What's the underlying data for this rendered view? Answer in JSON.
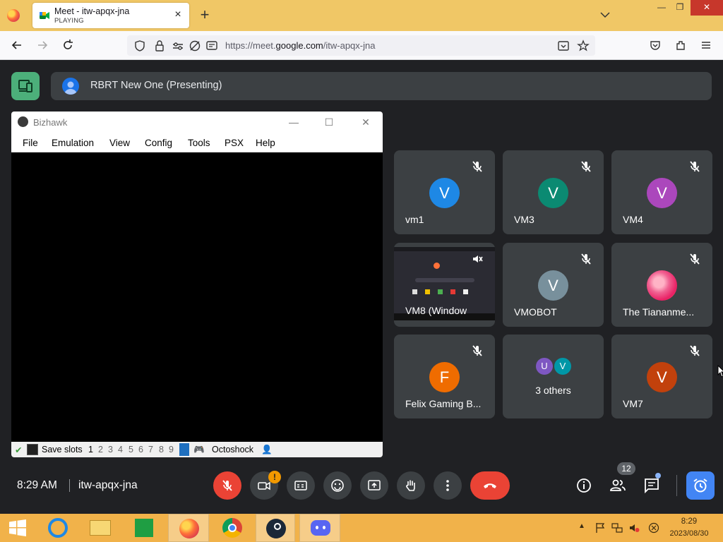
{
  "browser": {
    "tab": {
      "title": "Meet - itw-apqx-jna",
      "status": "PLAYING"
    },
    "url": {
      "prefix": "https://meet.",
      "domain": "google.com",
      "path": "/itw-apqx-jna"
    },
    "colors": {
      "tabstrip": "#f0c766"
    }
  },
  "meet": {
    "presenting_label": "RBRT New One (Presenting)",
    "shared_window": {
      "title": "Bizhawk",
      "menu": [
        "File",
        "Emulation",
        "View",
        "Config",
        "Tools",
        "PSX",
        "Help"
      ],
      "status": {
        "save_slots_label": "Save slots",
        "slots": [
          "1",
          "2",
          "3",
          "4",
          "5",
          "6",
          "7",
          "8",
          "9"
        ],
        "core": "Octoshock"
      }
    },
    "tiles": [
      {
        "name": "vm1",
        "initial": "V",
        "color": "#1e88e5"
      },
      {
        "name": "VM3",
        "initial": "V",
        "color": "#0b8a72"
      },
      {
        "name": "VM4",
        "initial": "V",
        "color": "#ab47bc"
      },
      {
        "name": "VM8 (Window",
        "initial": "",
        "color": ""
      },
      {
        "name": "VMOBOT",
        "initial": "V",
        "color": "#78909c"
      },
      {
        "name": "The Tiananme...",
        "initial": "",
        "color": ""
      },
      {
        "name": "Felix Gaming B...",
        "initial": "F",
        "color": "#ef6c00"
      },
      {
        "name": "3 others",
        "initial": "",
        "color": "",
        "mini": [
          "U",
          "V"
        ]
      },
      {
        "name": "VM7",
        "initial": "V",
        "color": "#c2410c"
      }
    ],
    "bottom": {
      "time": "8:29 AM",
      "meeting_code": "itw-apqx-jna",
      "people_count": "12"
    }
  },
  "taskbar": {
    "time": "8:29",
    "date": "2023/08/30"
  }
}
